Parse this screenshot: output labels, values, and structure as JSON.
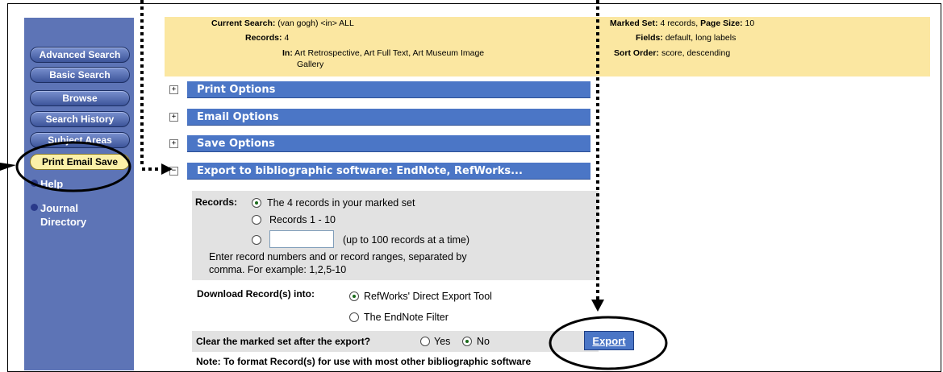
{
  "sidebar": {
    "buttons": [
      "Advanced Search",
      "Basic Search",
      "Browse",
      "Search History",
      "Subject Areas",
      "Print Email Save"
    ],
    "links": [
      "Help",
      "Journal",
      "Directory"
    ]
  },
  "search_info": {
    "current_search_label": "Current Search:",
    "current_search_value": "(van gogh) <in> ALL",
    "records_label": "Records:",
    "records_value": "4",
    "in_label": "In:",
    "in_value_line1": "Art Retrospective, Art Full Text, Art Museum Image",
    "in_value_line2": "Gallery",
    "marked_set_label": "Marked Set:",
    "marked_set_value": "4 records,",
    "page_size_label": "Page Size:",
    "page_size_value": "10",
    "fields_label": "Fields:",
    "fields_value": "default, long labels",
    "sort_order_label": "Sort Order:",
    "sort_order_value": "score, descending"
  },
  "sections": {
    "print": "Print Options",
    "email": "Email Options",
    "save": "Save Options",
    "export": "Export to bibliographic software: EndNote, RefWorks..."
  },
  "export_form": {
    "records_label": "Records:",
    "option_marked": "The 4 records in your marked set",
    "option_range": "Records 1 - 10",
    "range_input_value": "",
    "option_custom_hint": "(up to 100 records at a time)",
    "help_line1": "Enter record numbers and or record ranges, separated by",
    "help_line2": "comma. For example: 1,2,5-10",
    "download_label": "Download Record(s) into:",
    "option_refworks": "RefWorks' Direct Export Tool",
    "option_endnote": "The EndNote Filter",
    "clear_question": "Clear the marked set after the export?",
    "yes": "Yes",
    "no": "No",
    "export_button": "Export",
    "note": "Note: To format Record(s) for use with most other bibliographic software"
  }
}
